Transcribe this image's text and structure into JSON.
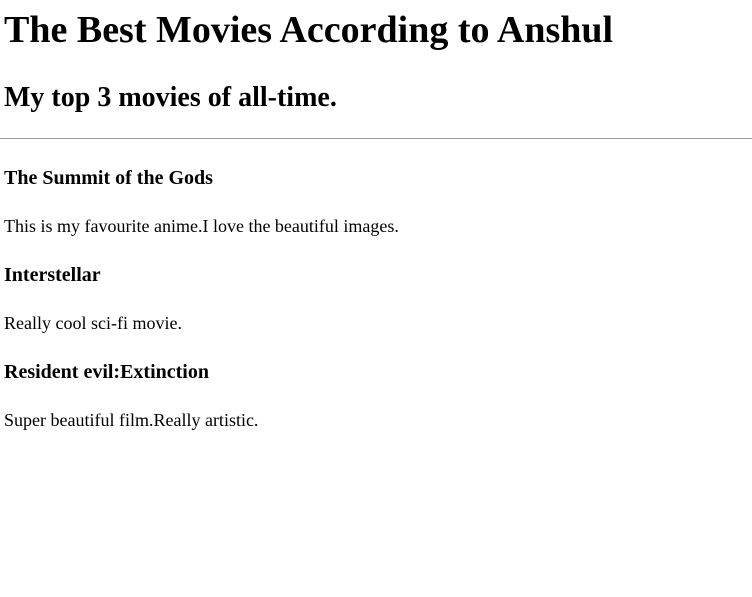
{
  "page": {
    "title": "The Best Movies According to Anshul",
    "subtitle": "My top 3 movies of all-time."
  },
  "movies": [
    {
      "title": "The Summit of the Gods",
      "description": "This is my favourite anime.I love the beautiful images."
    },
    {
      "title": "Interstellar",
      "description": "Really cool sci-fi movie."
    },
    {
      "title": "Resident evil:Extinction",
      "description": "Super beautiful film.Really artistic."
    }
  ]
}
